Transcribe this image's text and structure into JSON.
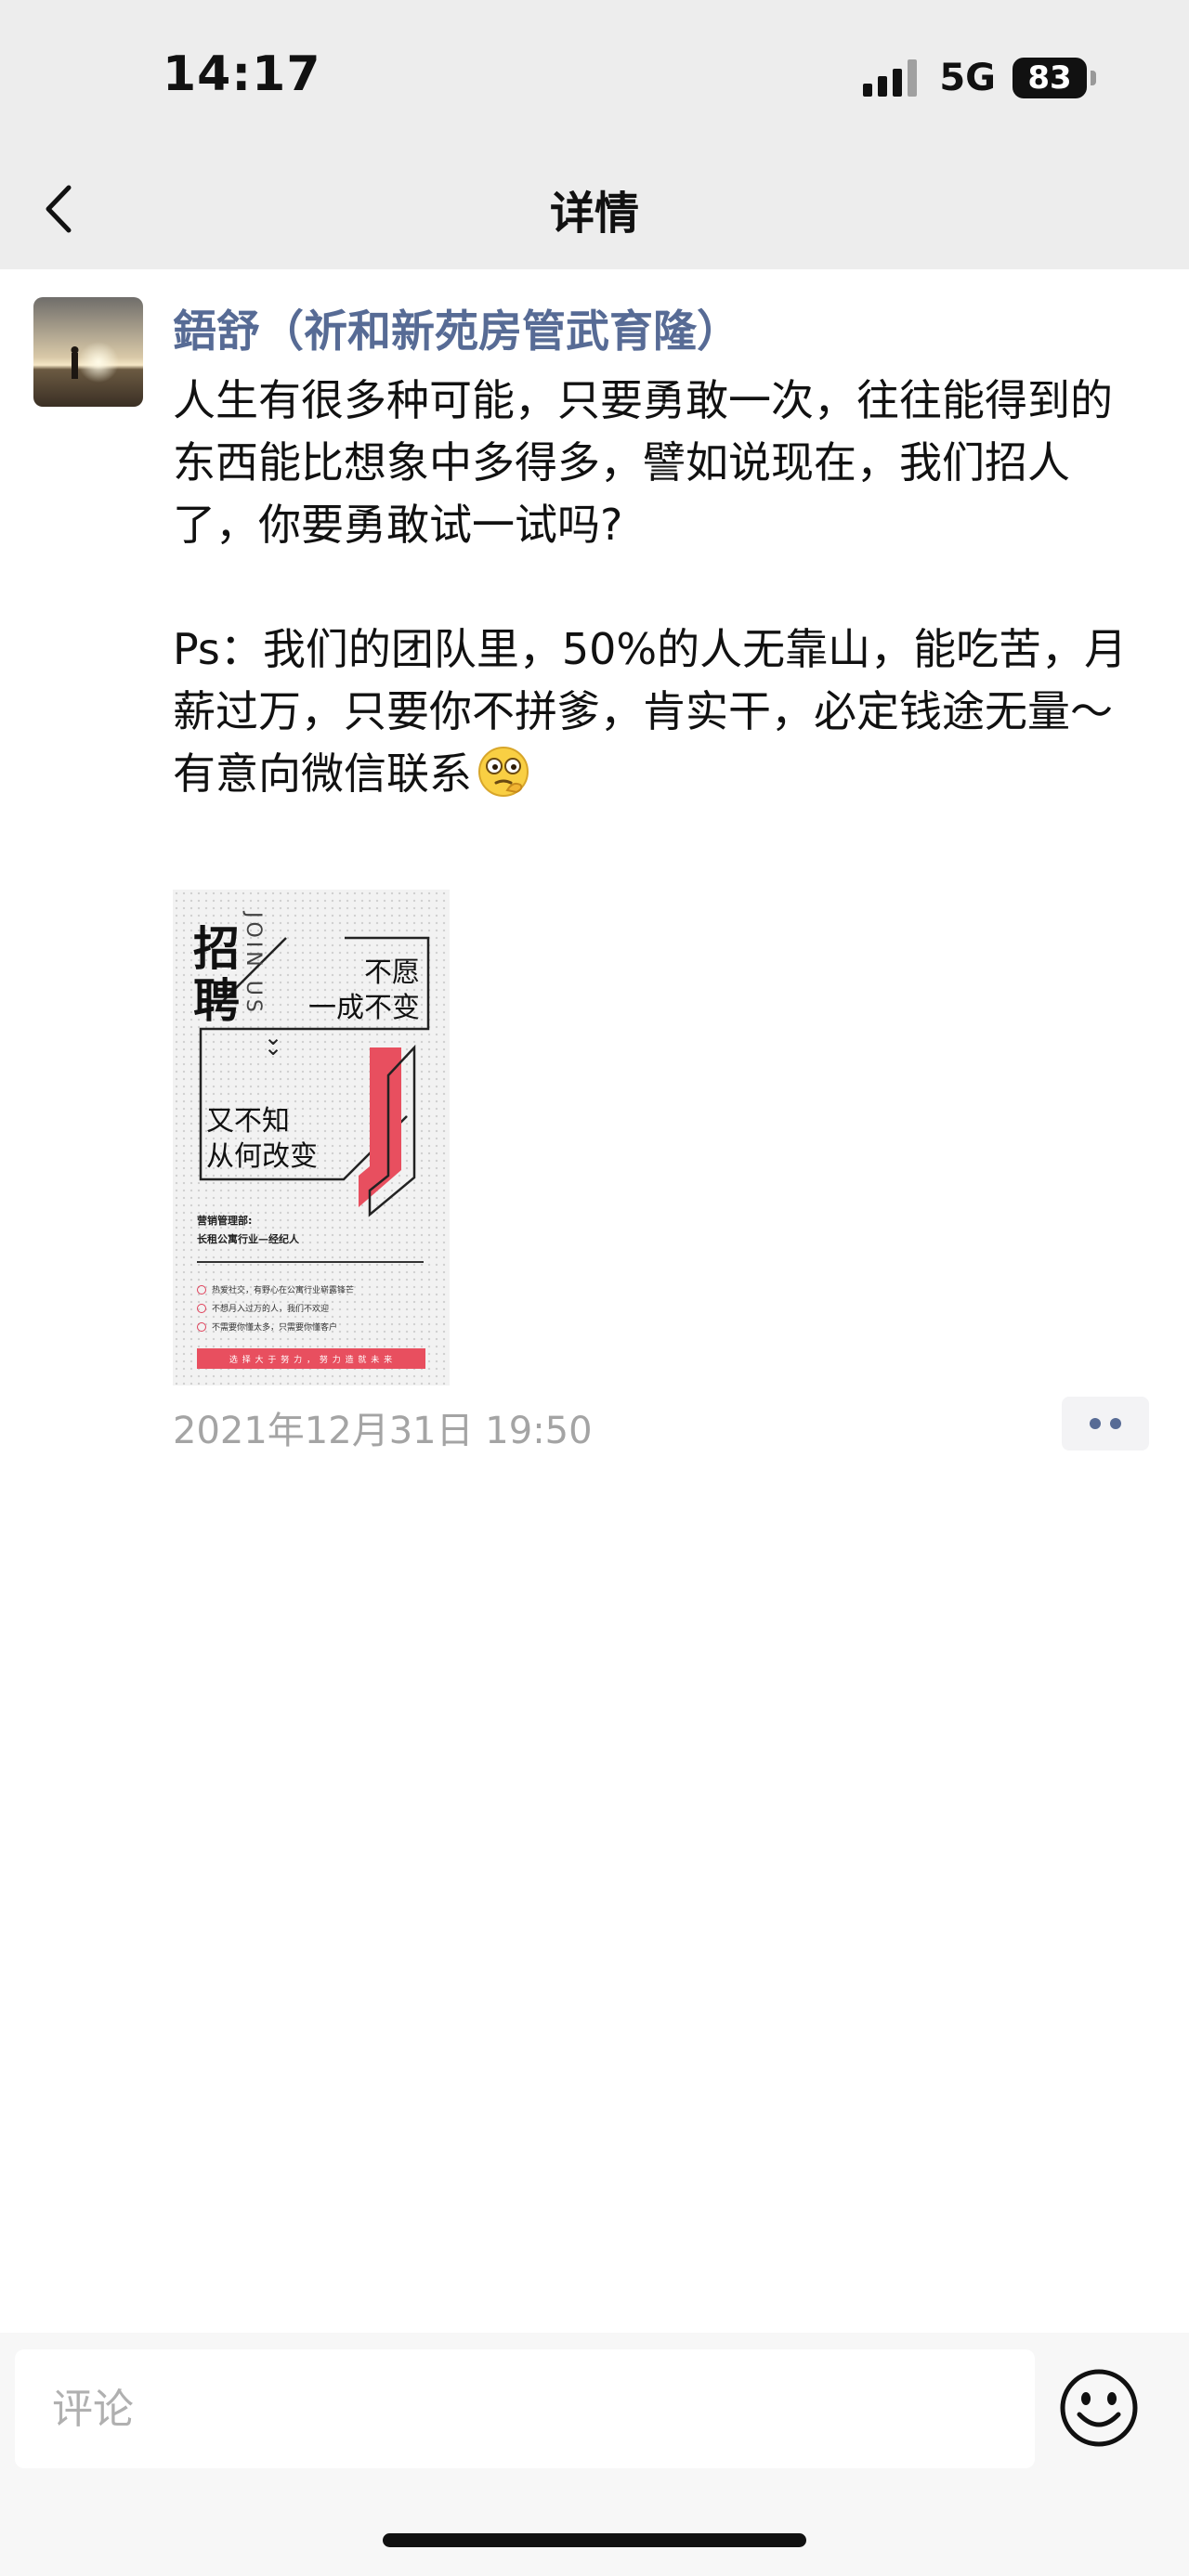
{
  "status_bar": {
    "time": "14:17",
    "network": "5G",
    "battery": "83"
  },
  "nav": {
    "back_icon": "chevron-left-icon",
    "title": "详情"
  },
  "post": {
    "author": "鋙舒（祈和新苑房管武育隆）",
    "paragraphs": [
      "人生有很多种可能，只要勇敢一次，往往能得到的东西能比想象中多得多，譬如说现在，我们招人了，你要勇敢试一试吗?",
      "Ps：我们的团队里，50%的人无靠山，能吃苦，月薪过万，只要你不拼爹，肯实干，必定钱途无量～",
      "有意向微信联系"
    ],
    "emoji": "thinking-face-emoji",
    "timestamp": "2021年12月31日 19:50",
    "poster": {
      "title_1": "招",
      "title_2": "聘",
      "join_text": "JOIN US",
      "line_1": "不愿",
      "line_2": "一成不变",
      "line_3": "又不知",
      "line_4": "从何改变",
      "dept": "营销管理部:",
      "role": "长租公寓行业—经纪人",
      "bullets": [
        "热爱社交，有野心在公寓行业崭露锋芒",
        "不想月入过万的人，我们不欢迎",
        "不需要你懂太多，只需要你懂客户"
      ],
      "bar_text": "选 择 大 于 努 力 ， 努 力 造 就 未 来",
      "accent_color": "#e84f5f"
    }
  },
  "comment": {
    "placeholder": "评论",
    "emoji_icon": "smiley-face-icon"
  },
  "colors": {
    "link_blue": "#576b95",
    "header_bg": "#ededed",
    "muted": "#a4a4a4"
  }
}
